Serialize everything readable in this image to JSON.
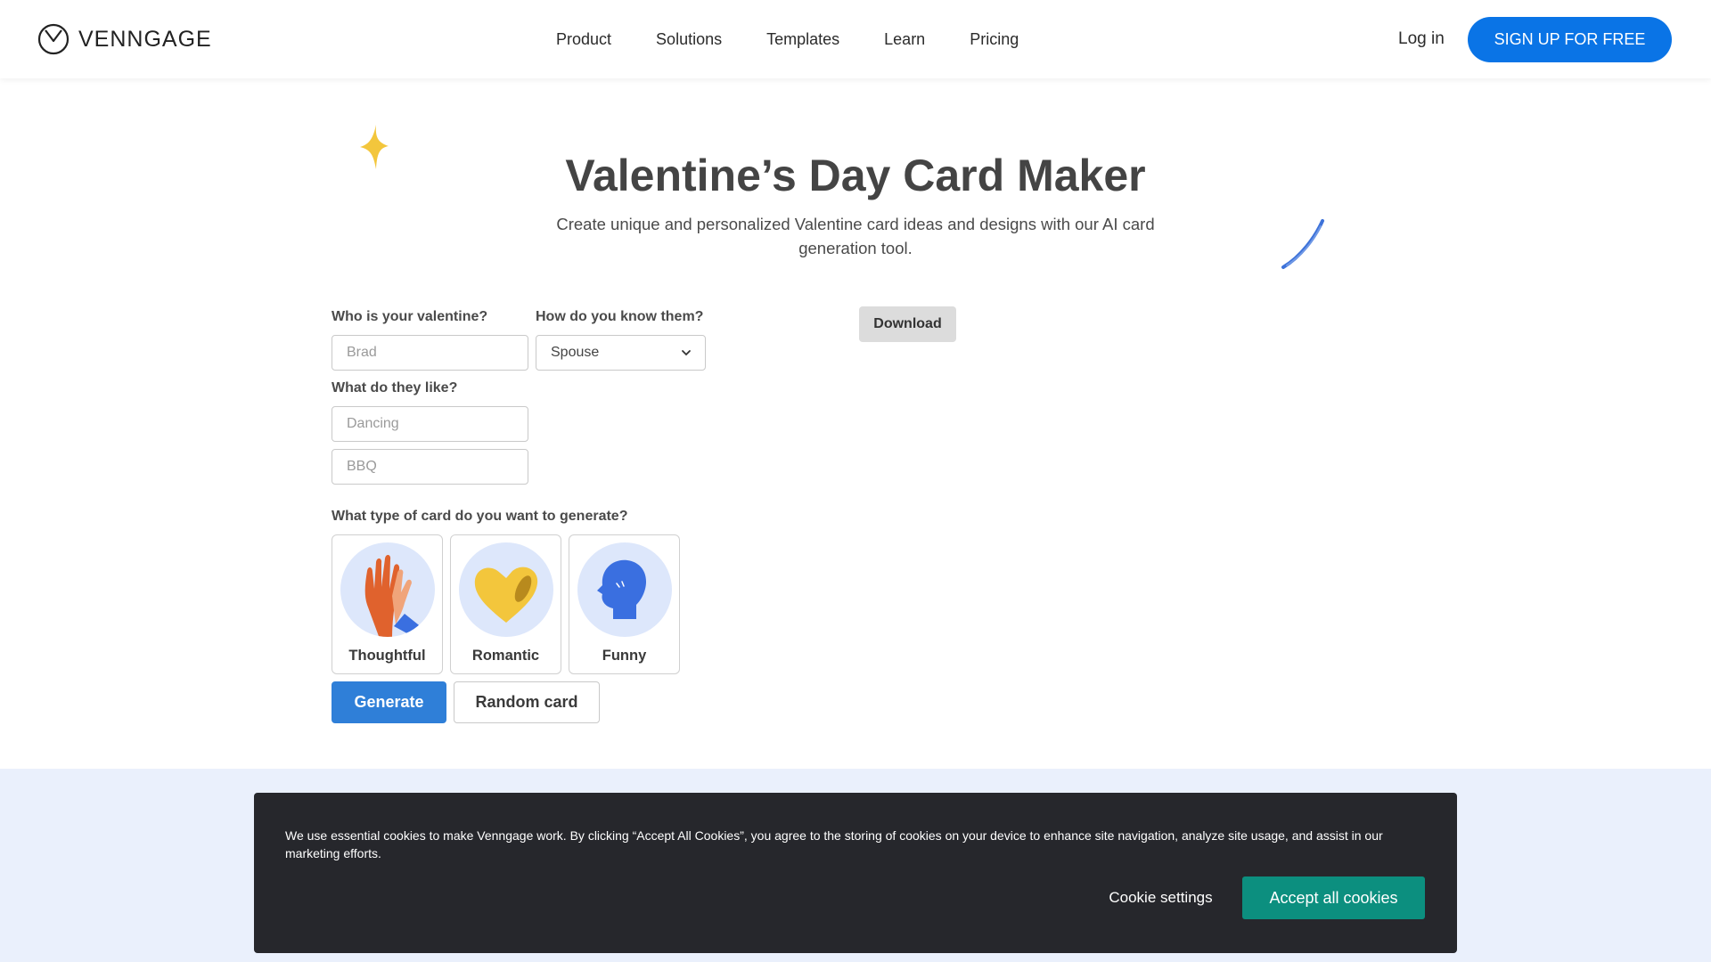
{
  "header": {
    "brand": "VENNGAGE",
    "nav": [
      "Product",
      "Solutions",
      "Templates",
      "Learn",
      "Pricing"
    ],
    "login": "Log in",
    "signup": "SIGN UP FOR FREE"
  },
  "hero": {
    "title": "Valentine’s Day Card Maker",
    "subtitle": "Create unique and personalized Valentine card ideas and designs with our AI card generation tool."
  },
  "form": {
    "who_label": "Who is your valentine?",
    "who_placeholder": "Brad",
    "know_label": "How do you know them?",
    "know_value": "Spouse",
    "like_label": "What do they like?",
    "like_placeholders": [
      "Dancing",
      "BBQ"
    ],
    "type_label": "What type of card do you want to generate?",
    "card_types": [
      {
        "label": "Thoughtful",
        "icon": "high-five-icon"
      },
      {
        "label": "Romantic",
        "icon": "heart-icon"
      },
      {
        "label": "Funny",
        "icon": "laughing-head-icon"
      }
    ],
    "generate": "Generate",
    "random": "Random card"
  },
  "preview": {
    "download": "Download"
  },
  "cookie": {
    "text": "We use essential cookies to make Venngage work. By clicking “Accept All Cookies”, you agree to the storing of cookies on your device to enhance site navigation, analyze site usage, and assist in our marketing efforts.",
    "settings": "Cookie settings",
    "accept": "Accept all cookies"
  },
  "colors": {
    "primary": "#0a74e6",
    "generate": "#2f7fd8",
    "accept": "#0c8f7f",
    "banner": "#26272c",
    "band": "#eaf0fc"
  }
}
